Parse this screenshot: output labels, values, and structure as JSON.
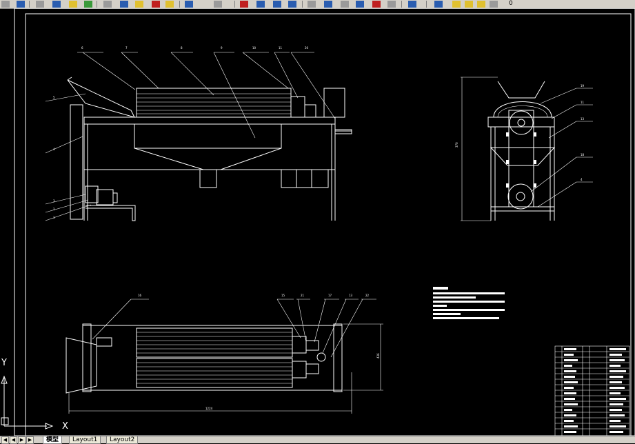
{
  "toolbar": {
    "layer_value": "0",
    "buttons": [
      "save-icon",
      "open-icon",
      "print-icon",
      "publish-icon",
      "cut-icon",
      "copy-icon",
      "paste-icon",
      "match-properties-icon",
      "undo-icon",
      "redo-icon",
      "pan-icon",
      "zoom-realtime-icon",
      "zoom-window-icon",
      "zoom-previous-icon",
      "properties-icon",
      "design-center-icon",
      "tool-palette-icon",
      "markup-icon",
      "calculator-icon",
      "help-icon",
      "layer-manager-icon",
      "layer-state-icon"
    ]
  },
  "ucs": {
    "y_label": "Y",
    "x_label": "X"
  },
  "tabs": [
    {
      "label": "模型",
      "active": true
    },
    {
      "label": "Layout1",
      "active": false
    },
    {
      "label": "Layout2",
      "active": false
    }
  ],
  "colors": {
    "background": "#000000",
    "linework": "#ffffff",
    "toolbar": "#d4d0c8"
  }
}
